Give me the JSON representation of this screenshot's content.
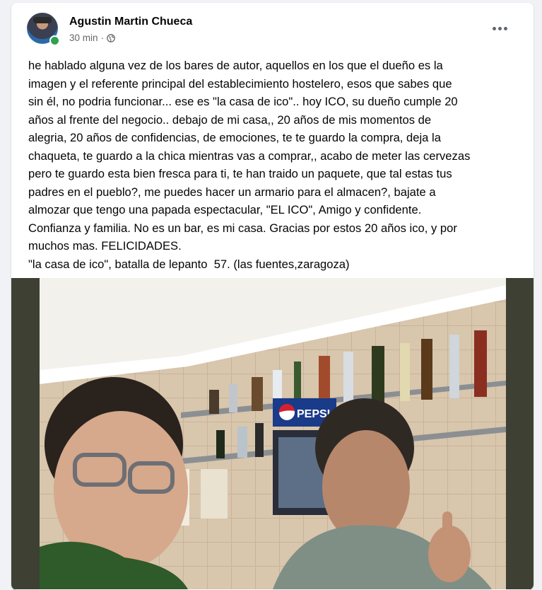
{
  "post": {
    "author": "Agustin Martin Chueca",
    "time": "30 min",
    "separator": "·",
    "text": "he hablado alguna vez de los bares de autor, aquellos en los que el dueño es la\nimagen y el referente principal del establecimiento hostelero, esos que sabes que\nsin él, no podria funcionar... ese es \"la casa de ico\".. hoy ICO, su dueño cumple 20\naños al frente del negocio.. debajo de mi casa,, 20 años de mis momentos de\nalegria, 20 años de confidencias, de emociones, te te guardo la compra, deja la\nchaqueta, te guardo a la chica mientras vas a comprar,, acabo de meter las cervezas\npero te guardo esta bien fresca para ti, te han traido un paquete, que tal estas tus\npadres en el pueblo?, me puedes hacer un armario para el almacen?, bajate a\nalmozar que tengo una papada espectacular, \"EL ICO\", Amigo y confidente.\nConfianza y familia. No es un bar, es mi casa. Gracias por estos 20 años ico, y por\nmuchos mas. FELICIDADES.\n\"la casa de ico\", batalla de lepanto  57. (las fuentes,zaragoza)",
    "photo_sign": "PEPSI"
  },
  "icons": {
    "privacy": "globe-icon",
    "menu": "more-options-icon"
  },
  "colors": {
    "author": "#050505",
    "meta": "#65676b",
    "online": "#31a24c",
    "background": "#f0f2f5"
  }
}
